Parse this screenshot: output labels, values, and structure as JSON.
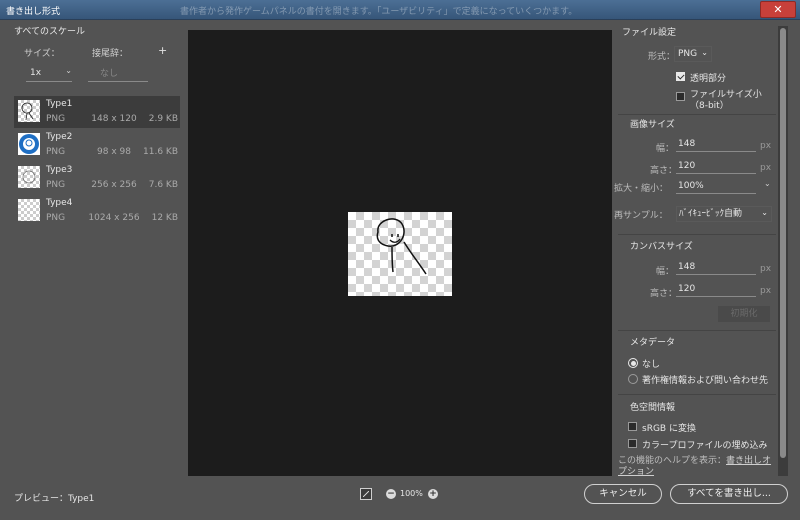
{
  "window": {
    "title": "書き出し形式",
    "ghost_title": "書作者から発作ゲームパネルの書付を開きます。「ユーザビリティ」で定義になっていくつかます。",
    "close_label": "✕"
  },
  "left": {
    "section_title": "すべてのスケール",
    "size_label": "サイズ：",
    "suffix_label": "接尾辞：",
    "add_label": "+",
    "scale_value": "1x",
    "suffix_placeholder": "なし",
    "assets": [
      {
        "name": "Type1",
        "format": "PNG",
        "dims": "148 x 120",
        "size": "2.9 KB",
        "selected": true
      },
      {
        "name": "Type2",
        "format": "PNG",
        "dims": "98 x 98",
        "size": "11.6 KB",
        "selected": false
      },
      {
        "name": "Type3",
        "format": "PNG",
        "dims": "256 x 256",
        "size": "7.6 KB",
        "selected": false
      },
      {
        "name": "Type4",
        "format": "PNG",
        "dims": "1024 x 256",
        "size": "12 KB",
        "selected": false
      }
    ]
  },
  "file_settings": {
    "title": "ファイル設定",
    "format_label": "形式：",
    "format_value": "PNG",
    "transparency_label": "透明部分",
    "transparency_checked": true,
    "smaller_file_label": "ファイルサイズ小（8-bit）",
    "smaller_file_checked": false
  },
  "image_size": {
    "title": "画像サイズ",
    "width_label": "幅：",
    "width_value": "148",
    "height_label": "高さ：",
    "height_value": "120",
    "unit": "px",
    "scale_label": "拡大・縮小：",
    "scale_value": "100%",
    "resample_label": "再サンプル：",
    "resample_value": "ﾊﾞｲｷｭｰﾋﾞｯｸ自動"
  },
  "canvas_size": {
    "title": "カンバスサイズ",
    "width_label": "幅：",
    "width_value": "148",
    "height_label": "高さ：",
    "height_value": "120",
    "unit": "px",
    "reset_label": "初期化"
  },
  "metadata": {
    "title": "メタデータ",
    "option_none": "なし",
    "option_copyright": "著作権情報および問い合わせ先",
    "selected": "none"
  },
  "color_space": {
    "title": "色空間情報",
    "srgb_label": "sRGB に変換",
    "embed_profile_label": "カラープロファイルの埋め込み"
  },
  "help": {
    "prefix": "この機能のヘルプを表示：",
    "link": "書き出しオプション"
  },
  "bottom": {
    "preview_label": "プレビュー：Type1",
    "zoom_value": "100%",
    "zoom_out": "−",
    "zoom_in": "+",
    "cancel_label": "キャンセル",
    "export_all_label": "すべてを書き出し..."
  }
}
